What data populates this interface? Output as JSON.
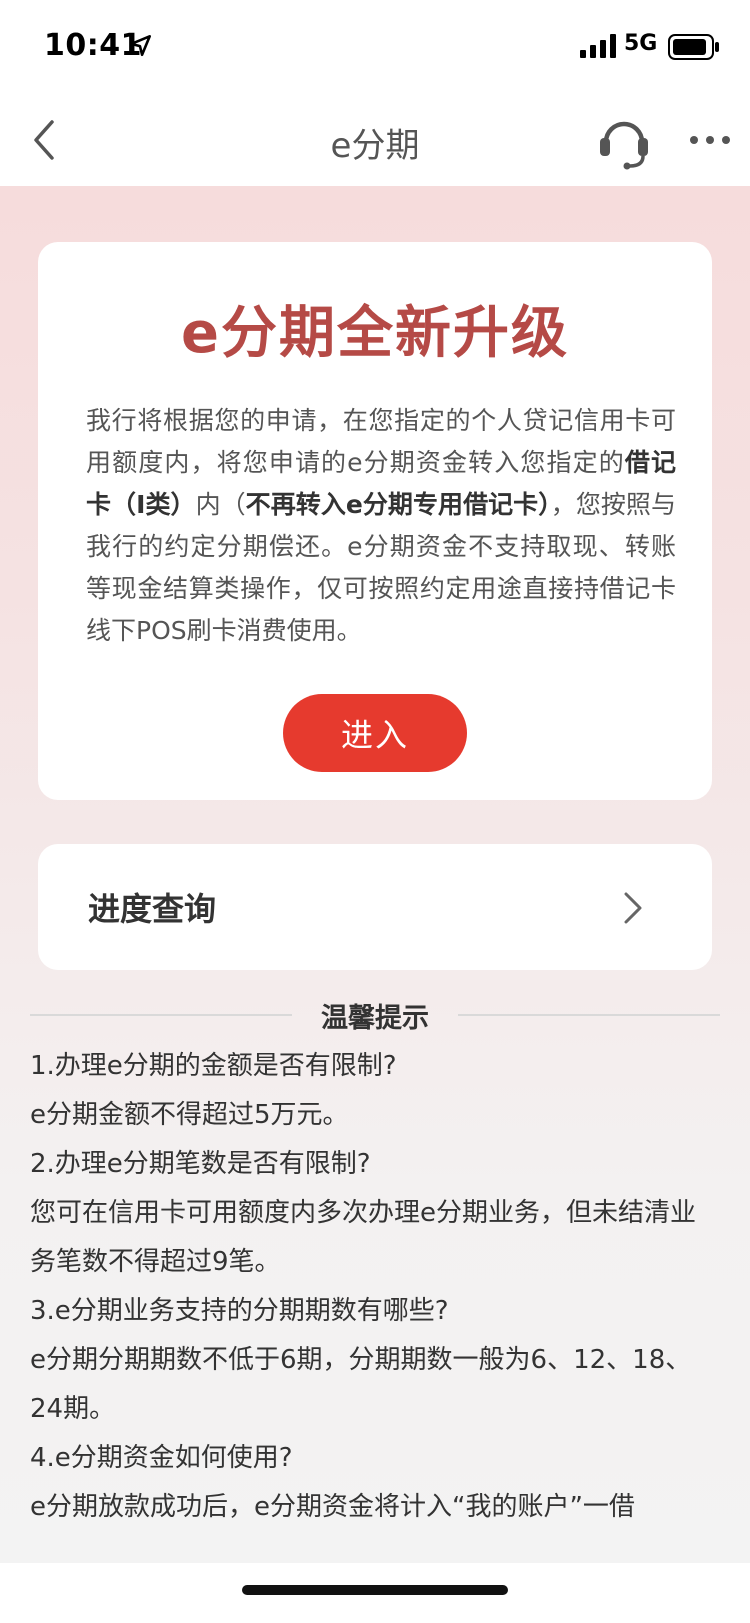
{
  "status_bar": {
    "time": "10:41",
    "network": "5G"
  },
  "nav": {
    "title": "e分期"
  },
  "promo": {
    "title": "e分期全新升级",
    "text_1": "我行将根据您的申请，在您指定的个人贷记信用卡可用额度内，将您申请的e分期资金转入您指定的",
    "bold_1": "借记卡（I类）",
    "text_2": "内（",
    "bold_2": "不再转入e分期专用借记卡）",
    "text_3": "，您按照与我行的约定分期偿还。e分期资金不支持取现、转账等现金结算类操作，仅可按照约定用途直接持借记卡线下POS刷卡消费使用。",
    "button_label": "进入"
  },
  "progress": {
    "label": "进度查询"
  },
  "tips": {
    "title": "温馨提示",
    "lines": [
      "1.办理e分期的金额是否有限制?",
      "e分期金额不得超过5万元。",
      "2.办理e分期笔数是否有限制?",
      "您可在信用卡可用额度内多次办理e分期业务，但未结清业务笔数不得超过9笔。",
      "3.e分期业务支持的分期期数有哪些?",
      "e分期分期期数不低于6期，分期期数一般为6、12、18、24期。",
      "4.e分期资金如何使用?",
      "e分期放款成功后，e分期资金将计入“我的账户”一借"
    ]
  },
  "colors": {
    "accent": "#e63a2e",
    "title": "#b54a46"
  }
}
